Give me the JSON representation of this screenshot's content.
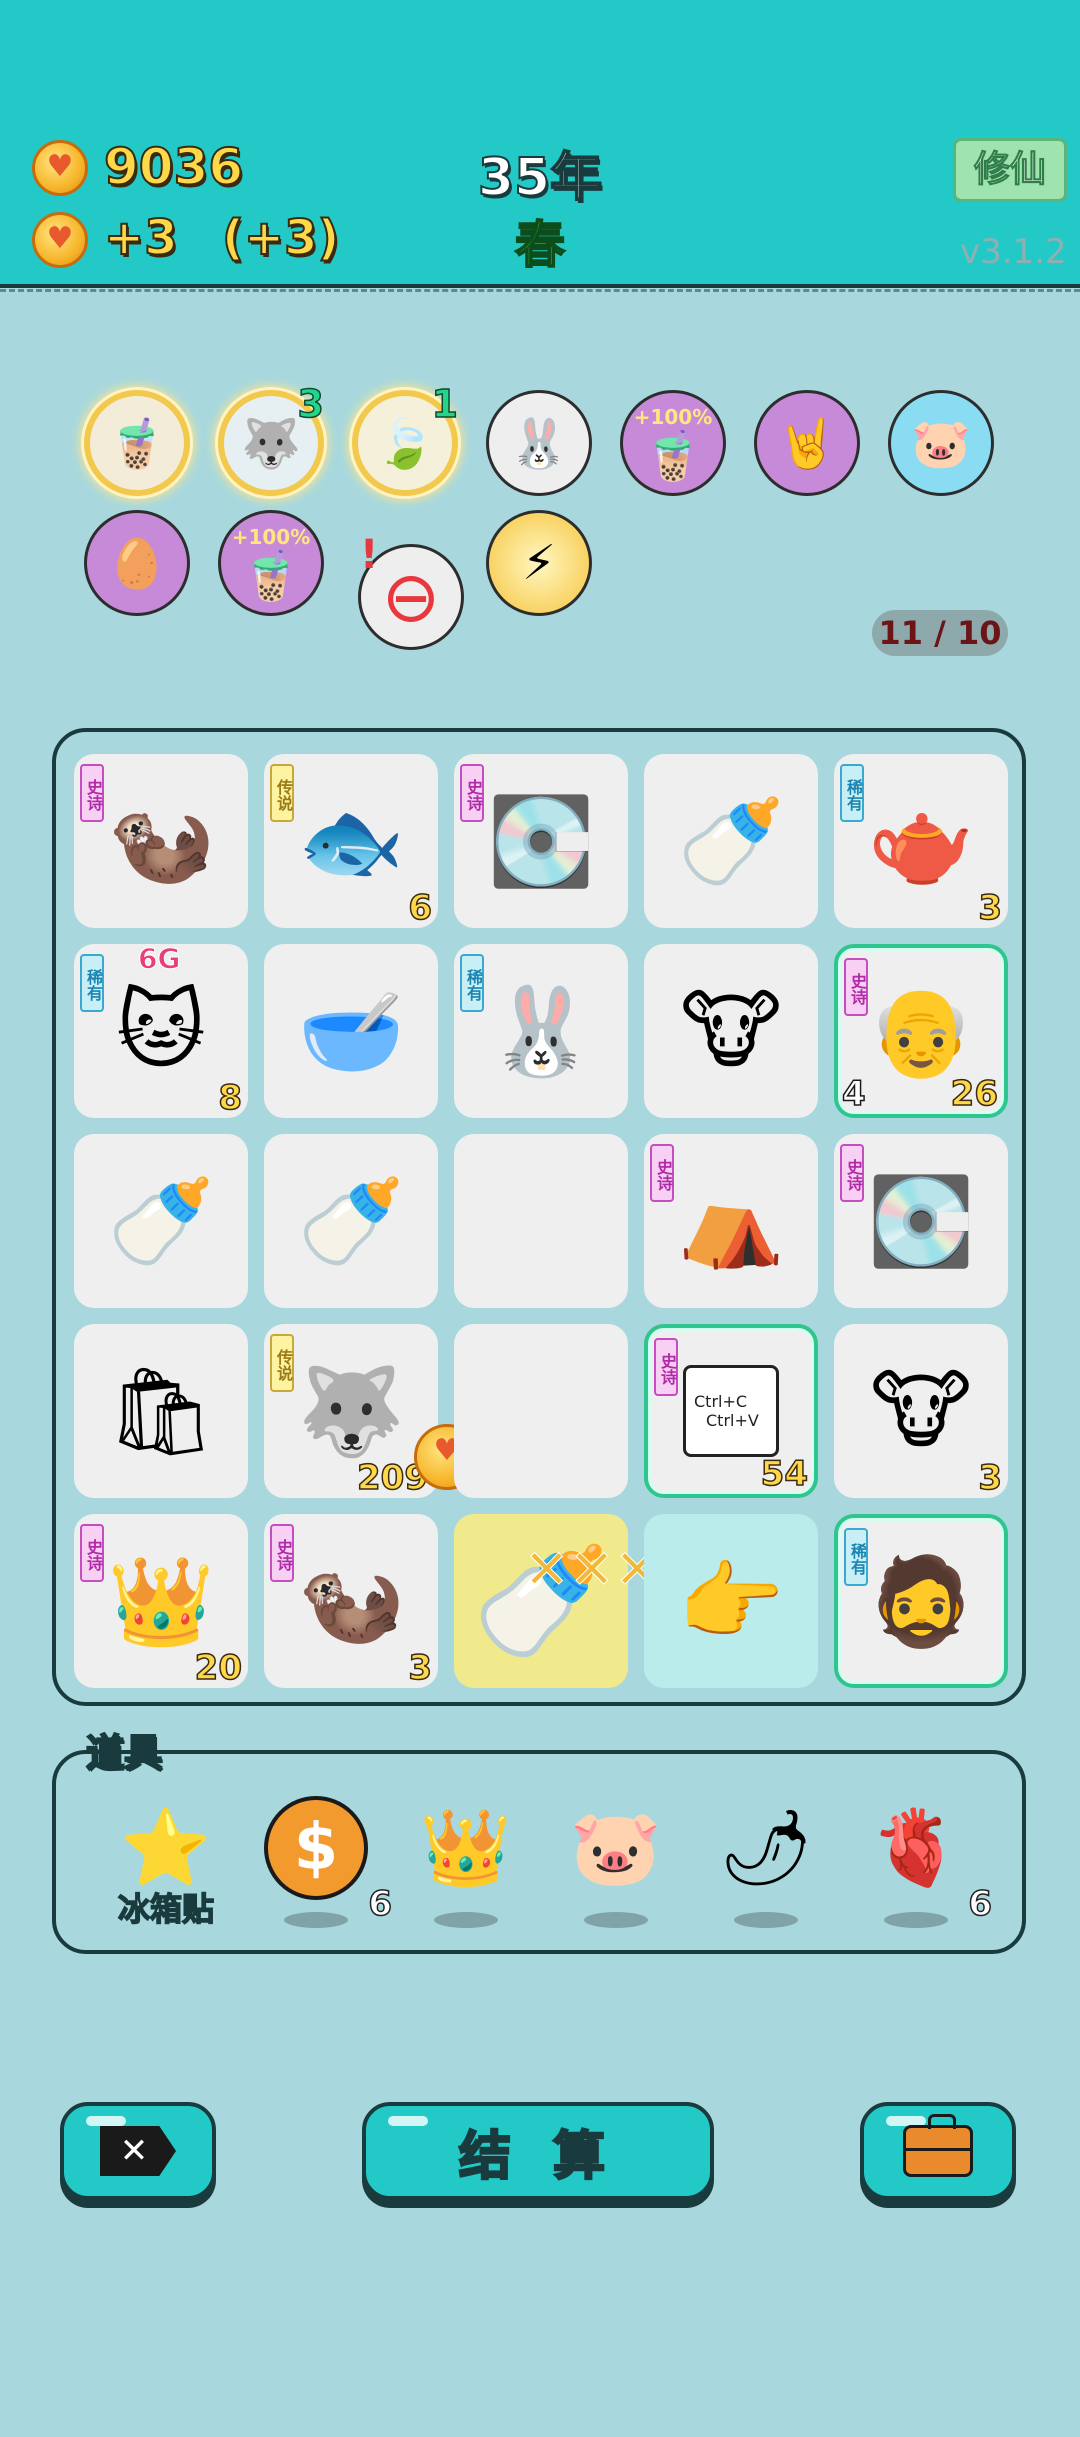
{
  "header": {
    "coins": "9036",
    "income": "+3",
    "income_extra": "(+3)",
    "year": "35年",
    "season": "春",
    "mode_button": "修仙",
    "version": "v3.1.2"
  },
  "buffs": [
    {
      "icon": "bubble-tea-icon",
      "glyph": "🧋",
      "count": ""
    },
    {
      "icon": "husky-dog-icon",
      "glyph": "🐺",
      "count": "3"
    },
    {
      "icon": "leaf-icon",
      "glyph": "🍃",
      "count": "1"
    },
    {
      "icon": "rabbit-icon",
      "glyph": "🐰",
      "count": ""
    },
    {
      "icon": "milk-tea-bonus-icon",
      "glyph": "🧋",
      "pct": "+100%"
    },
    {
      "icon": "rock-hand-icon",
      "glyph": "🤘",
      "count": ""
    },
    {
      "icon": "piggy-bank-icon",
      "glyph": "🐷",
      "count": ""
    },
    {
      "icon": "egg-bag-icon",
      "glyph": "🥚",
      "count": ""
    },
    {
      "icon": "milk-tea-bonus-icon",
      "glyph": "🧋",
      "pct": "+100%"
    },
    {
      "icon": "minus-icon",
      "glyph": "⊖",
      "count": ""
    },
    {
      "icon": "lightning-icon",
      "glyph": "⚡",
      "count": ""
    }
  ],
  "capacity": "11 / 10",
  "board": {
    "rows": [
      [
        {
          "name": "otter",
          "glyph": "🦦",
          "tag": "史诗",
          "tier": "epic",
          "num": ""
        },
        {
          "name": "koi-fish",
          "glyph": "🐟",
          "tag": "传说",
          "tier": "legend",
          "num": "6"
        },
        {
          "name": "graphics-card",
          "glyph": "💽",
          "tag": "史诗",
          "tier": "epic",
          "num": ""
        },
        {
          "name": "milk-bottle",
          "glyph": "🍼",
          "tag": "",
          "tier": "",
          "num": ""
        },
        {
          "name": "teapot",
          "glyph": "🫖",
          "tag": "稀有",
          "tier": "rare",
          "num": "3"
        }
      ],
      [
        {
          "name": "cat",
          "glyph": "🐱",
          "tag": "稀有",
          "tier": "rare",
          "num": "8",
          "extra": "6G"
        },
        {
          "name": "bowl",
          "glyph": "🥣",
          "tag": "",
          "tier": "",
          "num": ""
        },
        {
          "name": "rabbit",
          "glyph": "🐰",
          "tag": "稀有",
          "tier": "rare",
          "num": ""
        },
        {
          "name": "cow",
          "glyph": "🐮",
          "tag": "",
          "tier": "",
          "num": ""
        },
        {
          "name": "old-man",
          "glyph": "👴",
          "tag": "史诗",
          "tier": "epic",
          "num": "26",
          "left": "4",
          "hl": true
        }
      ],
      [
        {
          "name": "milk-bottle",
          "glyph": "🍼",
          "tag": "",
          "tier": "",
          "num": ""
        },
        {
          "name": "milk-bottle",
          "glyph": "🍼",
          "tag": "",
          "tier": "",
          "num": ""
        },
        {
          "name": "empty",
          "glyph": "",
          "tag": "",
          "tier": "",
          "num": ""
        },
        {
          "name": "rabbit-tent",
          "glyph": "⛺",
          "tag": "史诗",
          "tier": "epic",
          "num": ""
        },
        {
          "name": "graphics-card",
          "glyph": "💽",
          "tag": "史诗",
          "tier": "epic",
          "num": ""
        }
      ],
      [
        {
          "name": "garbage-bag",
          "glyph": "🛍",
          "tag": "",
          "tier": "",
          "num": ""
        },
        {
          "name": "husky",
          "glyph": "🐺",
          "tag": "传说",
          "tier": "legend",
          "num": "209"
        },
        {
          "name": "empty",
          "glyph": "",
          "tag": "",
          "tier": "",
          "num": ""
        },
        {
          "name": "ctrl-c-ctrl-v",
          "glyph": "",
          "tag": "史诗",
          "tier": "epic",
          "num": "54",
          "hl": true,
          "ctrl1": "Ctrl+C",
          "ctrl2": "Ctrl+V"
        },
        {
          "name": "cow",
          "glyph": "🐮",
          "tag": "",
          "tier": "",
          "num": "3"
        }
      ],
      [
        {
          "name": "king-face",
          "glyph": "👑",
          "tag": "史诗",
          "tier": "epic",
          "num": "20"
        },
        {
          "name": "otter",
          "glyph": "🦦",
          "tag": "史诗",
          "tier": "epic",
          "num": "3"
        },
        {
          "name": "milk-bottle",
          "glyph": "🍼",
          "tag": "",
          "tier": "",
          "num": "",
          "bg": "yellow"
        },
        {
          "name": "pointing-hand",
          "glyph": "👉",
          "tag": "",
          "tier": "",
          "num": "",
          "bg": "cyan"
        },
        {
          "name": "man-with-hat",
          "glyph": "🧔",
          "tag": "稀有",
          "tier": "rare",
          "num": "",
          "hl": true
        }
      ]
    ]
  },
  "props": {
    "title": "道具",
    "items": [
      {
        "icon": "star-icon",
        "glyph": "⭐",
        "label": "冰箱贴",
        "num": ""
      },
      {
        "icon": "dollar-coin-icon",
        "glyph": "💲",
        "label": "",
        "num": "6"
      },
      {
        "icon": "crown-icon",
        "glyph": "👑",
        "label": "",
        "num": ""
      },
      {
        "icon": "piggy-bank-icon",
        "glyph": "🐷",
        "label": "",
        "num": ""
      },
      {
        "icon": "chili-pepper-icon",
        "glyph": "🌶",
        "label": "",
        "num": ""
      },
      {
        "icon": "liver-icon",
        "glyph": "🫀",
        "label": "",
        "num": "6"
      }
    ]
  },
  "buttons": {
    "settle": "结 算"
  },
  "colors": {
    "accent": "#22c9c6",
    "background": "#a8d8de",
    "outline": "#1a3b3e",
    "gold": "#ffd84a"
  }
}
